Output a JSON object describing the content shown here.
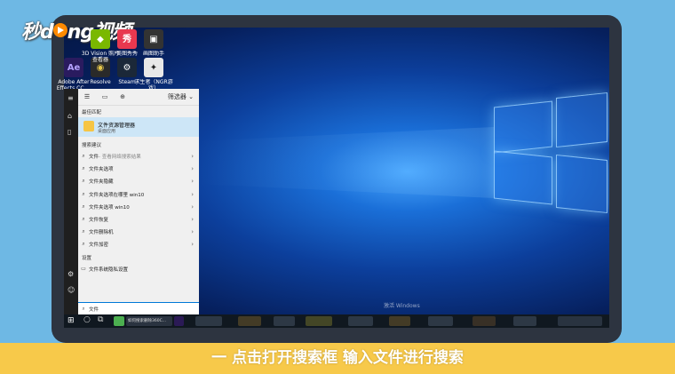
{
  "watermark": {
    "prefix": "秒",
    "suffix": "ng视频",
    "middle": "d"
  },
  "desktop_icons": [
    {
      "name": "ae-icon",
      "label": "Adobe After Effects CC ...",
      "glyph": "Ae",
      "color": "#2a1b5f",
      "fg": "#b4a2ff"
    },
    {
      "name": "resolve-icon",
      "label": "Resolve",
      "glyph": "◉",
      "color": "#2a2a2a",
      "fg": "#e7c74a"
    },
    {
      "name": "steam-icon",
      "label": "Steam",
      "glyph": "⚙",
      "color": "#1b2838",
      "fg": "#ffffff"
    },
    {
      "name": "game-icon",
      "label": "求生者（NGR游戏）",
      "glyph": "✦",
      "color": "#e8e8e8",
      "fg": "#222"
    },
    {
      "name": "3dvision-icon",
      "label": "3D Vision 照片查看器",
      "glyph": "◆",
      "color": "#7ab800",
      "fg": "#fff"
    },
    {
      "name": "meitu-icon",
      "label": "美图秀秀",
      "glyph": "秀",
      "color": "#e8384f",
      "fg": "#fff"
    },
    {
      "name": "app-icon",
      "label": "画图助手",
      "glyph": "▣",
      "color": "#333",
      "fg": "#fff"
    }
  ],
  "start_menu": {
    "top_tabs": [
      "☰",
      "▭",
      "⊕"
    ],
    "filter_label": "筛选器",
    "best_match_title": "最佳匹配",
    "best_match": {
      "name": "文件资源管理器",
      "sub": "桌面应用"
    },
    "suggest_title": "搜索建议",
    "suggestions": [
      {
        "text": "文件",
        "extra": " - 查看网络搜索结果"
      },
      {
        "text": "文件夹选项",
        "extra": ""
      },
      {
        "text": "文件夹隐藏",
        "extra": ""
      },
      {
        "text": "文件夹选项在哪里 win10",
        "extra": ""
      },
      {
        "text": "文件夹选项 win10",
        "extra": ""
      },
      {
        "text": "文件恢复",
        "extra": ""
      },
      {
        "text": "文件删除机",
        "extra": ""
      },
      {
        "text": "文件加密",
        "extra": ""
      }
    ],
    "settings_title": "设置",
    "settings_item": "文件系统隐私设置",
    "search_value": "文件"
  },
  "taskbar": {
    "active_label": "如何搜索删除360C..."
  },
  "activate_text": "激活 Windows",
  "caption": "一 点击打开搜索框 输入文件进行搜索"
}
